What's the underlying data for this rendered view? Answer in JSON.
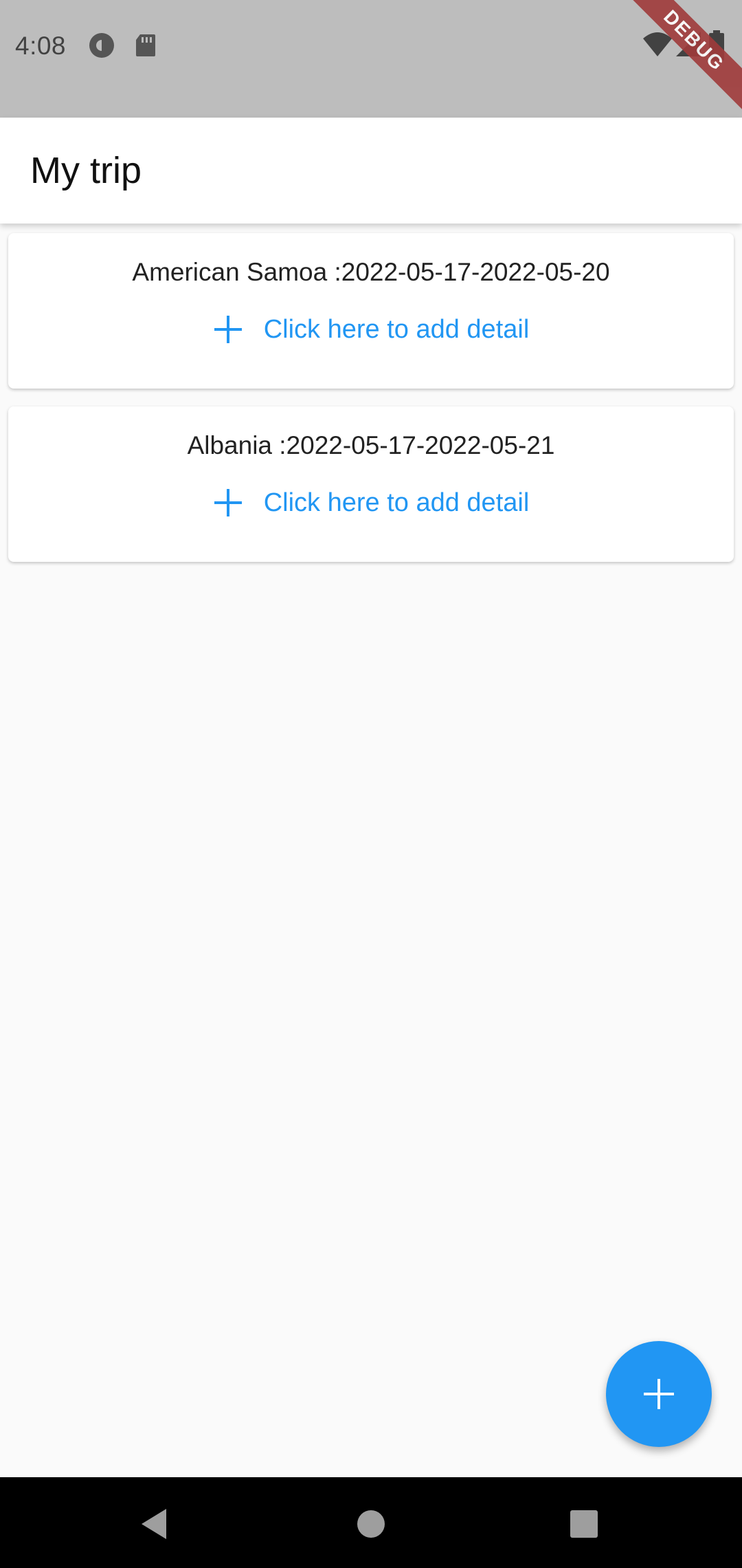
{
  "status_bar": {
    "time": "4:08",
    "debug_label": "DEBUG",
    "icons": [
      "cast-icon",
      "sd-card-icon",
      "wifi-icon",
      "signal-icon",
      "battery-icon"
    ]
  },
  "app_bar": {
    "title": "My trip"
  },
  "trips": [
    {
      "title": "American Samoa :2022-05-17-2022-05-20",
      "action_label": "Click here to add detail"
    },
    {
      "title": "Albania :2022-05-17-2022-05-21",
      "action_label": "Click here to add detail"
    }
  ],
  "fab": {
    "icon": "plus-icon"
  },
  "nav_bar": {
    "buttons": [
      "back-icon",
      "home-icon",
      "recents-icon"
    ]
  },
  "colors": {
    "accent": "#2196f3",
    "status_bar": "#bdbdbd",
    "background": "#fafafa",
    "debug_ribbon": "#a03b3b"
  }
}
